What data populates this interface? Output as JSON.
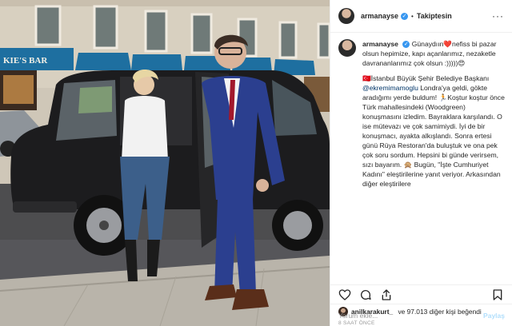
{
  "post": {
    "username": "armanayse",
    "verified_mark": "✓",
    "separator": "•",
    "follow_status": "Takiptesin",
    "more_glyph": "···"
  },
  "caption": {
    "username": "armanayse",
    "line1": "Günaydıın❤️nefiss bi pazar olsun hepimize, kapı açanlarımız, nezaketle davrananlarımız çok olsun :)))))😍",
    "p2_a": "🇹🇷İstanbul Büyük Şehir Belediye Başkanı ",
    "p2_mention": "@ekremimamoglu",
    "p2_b": " Londra'ya geldi, gökte aradığımı yerde buldum! 🏃Koştur koştur önce Türk mahallesindeki (Woodgreen) konuşmasını izledim. Bayraklara karşılandı. O ise mütevazı ve çok samimiydi. İyi de bir konuşmacı, ayakta alkışlandı. Sonra ertesi günü Rüya Restoran'da buluştuk ve ona pek çok soru sordum. Hepsini bi günde verirsem, sızı bayarım. 🙊 Bugün, \"İşte Cumhuriyet Kadını\" eleştirilerine yanıt veriyor. Arkasından diğer eleştirilere"
  },
  "likes": {
    "first_user": "anilkarakurt_",
    "rest": " ve 97.013 diğer kişi beğendi"
  },
  "timestamp": "8 SAAT ÖNCE",
  "comment": {
    "placeholder": "Yorum ekle...",
    "post_label": "Paylaş"
  },
  "icons": [
    "heart-icon",
    "comment-icon",
    "share-icon",
    "bookmark-icon"
  ],
  "photo": {
    "shop_sign": "KIE'S BAR"
  }
}
